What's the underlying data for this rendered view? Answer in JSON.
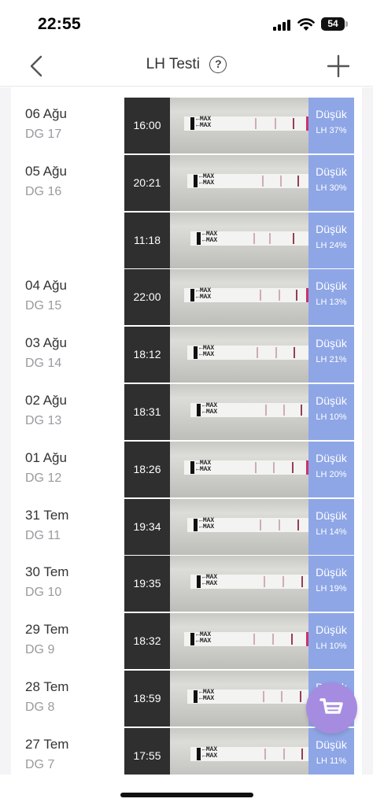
{
  "status_bar": {
    "time": "22:55",
    "battery": "54"
  },
  "nav": {
    "title": "LH Testi",
    "help_glyph": "?",
    "back_icon": "chevron-left-icon",
    "add_icon": "plus-icon"
  },
  "colors": {
    "level_pane": "#8ea6e6",
    "cart_button": "#a58ce0",
    "time_pane": "#2f2f2f"
  },
  "entries": [
    {
      "date": "06 Ağu",
      "cycle_day": "DG 17",
      "time": "16:00",
      "level": "Düşük",
      "lh": "LH 37%"
    },
    {
      "date": "05 Ağu",
      "cycle_day": "DG 16",
      "time": "20:21",
      "level": "Düşük",
      "lh": "LH 30%"
    },
    {
      "date": "",
      "cycle_day": "",
      "time": "11:18",
      "level": "Düşük",
      "lh": "LH 24%"
    },
    {
      "date": "04 Ağu",
      "cycle_day": "DG 15",
      "time": "22:00",
      "level": "Düşük",
      "lh": "LH 13%"
    },
    {
      "date": "03 Ağu",
      "cycle_day": "DG 14",
      "time": "18:12",
      "level": "Düşük",
      "lh": "LH 21%"
    },
    {
      "date": "02 Ağu",
      "cycle_day": "DG 13",
      "time": "18:31",
      "level": "Düşük",
      "lh": "LH 10%"
    },
    {
      "date": "01 Ağu",
      "cycle_day": "DG 12",
      "time": "18:26",
      "level": "Düşük",
      "lh": "LH 20%"
    },
    {
      "date": "31 Tem",
      "cycle_day": "DG 11",
      "time": "19:34",
      "level": "Düşük",
      "lh": "LH 14%"
    },
    {
      "date": "30 Tem",
      "cycle_day": "DG 10",
      "time": "19:35",
      "level": "Düşük",
      "lh": "LH 19%"
    },
    {
      "date": "29 Tem",
      "cycle_day": "DG 9",
      "time": "18:32",
      "level": "Düşük",
      "lh": "LH 10%"
    },
    {
      "date": "28 Tem",
      "cycle_day": "DG 8",
      "time": "18:59",
      "level": "Düşük",
      "lh": ""
    },
    {
      "date": "27 Tem",
      "cycle_day": "DG 7",
      "time": "17:55",
      "level": "Düşük",
      "lh": "LH 11%"
    }
  ],
  "strip_text": "MAX",
  "cart_icon": "shopping-cart-icon"
}
